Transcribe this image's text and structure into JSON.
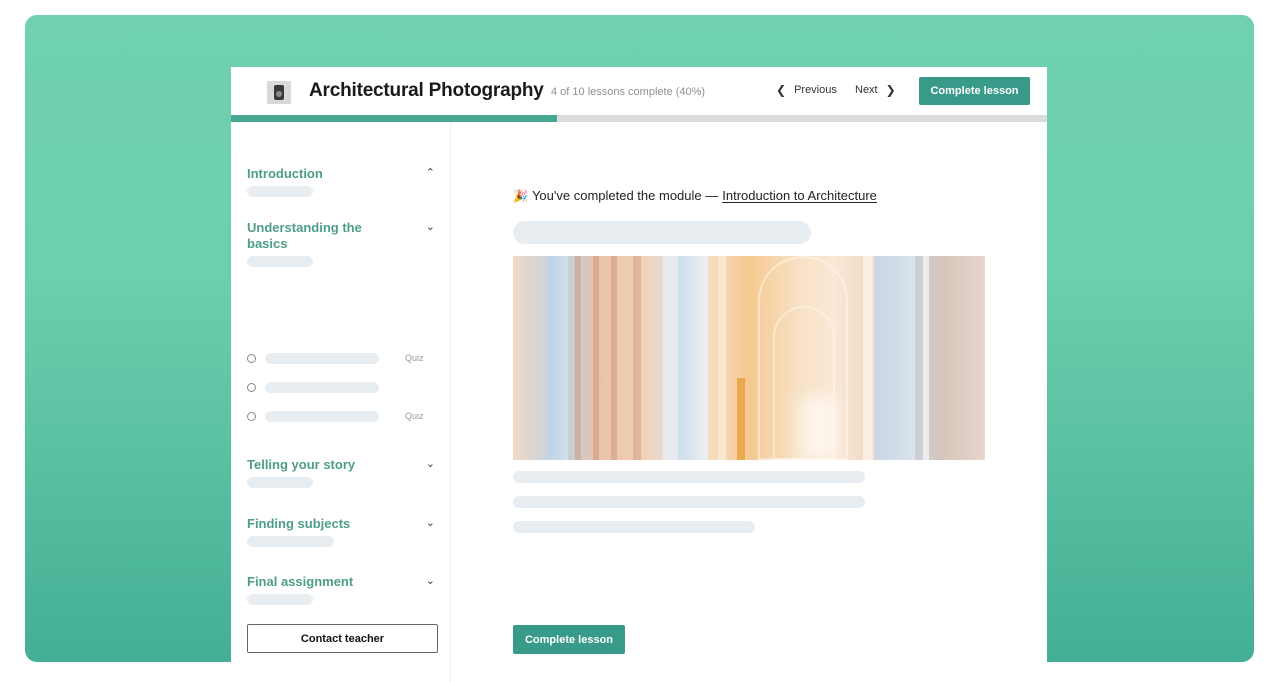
{
  "header": {
    "logo_icon": "camera-icon",
    "title": "Architectural Photography",
    "progress_text": "4 of 10 lessons complete (40%)",
    "progress_fraction": 0.4,
    "previous_label": "Previous",
    "next_label": "Next",
    "complete_label": "Complete lesson"
  },
  "sidebar": {
    "sections": [
      {
        "title": "Introduction",
        "expanded": true
      },
      {
        "title": "Understanding the basics",
        "expanded": false
      },
      {
        "title": "Telling your story",
        "expanded": false
      },
      {
        "title": "Finding subjects",
        "expanded": false
      },
      {
        "title": "Final assignment",
        "expanded": false
      }
    ],
    "lessons": [
      {
        "tag": "Quiz"
      },
      {
        "tag": ""
      },
      {
        "tag": "Quiz"
      }
    ],
    "contact_label": "Contact teacher"
  },
  "main": {
    "emoji": "🎉",
    "message": "You've completed the module —",
    "module_link": "Introduction to Architecture",
    "image_alt": "Cathedral interior with tall brick columns and vaulted arches",
    "complete_label": "Complete lesson"
  },
  "colors": {
    "accent": "#389a88",
    "section_title": "#4d9e88",
    "progress_fill": "#46a890",
    "backdrop": "#6fd1b0"
  }
}
